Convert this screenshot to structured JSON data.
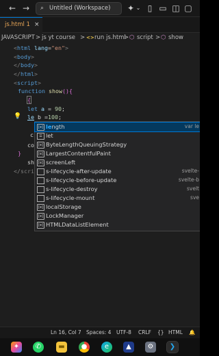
{
  "titlebar": {
    "search_text": "Untitled (Workspace)",
    "icons": [
      "back-arrow-icon",
      "forward-arrow-icon",
      "search-icon",
      "copilot-icon",
      "chevron-down-icon",
      "layout-sidebar-icon",
      "layout-panel-icon",
      "layout-secondary-icon"
    ]
  },
  "tab": {
    "label": "js.html 1",
    "close": "×"
  },
  "breadcrumb": {
    "p1": "JAVASCRIPT",
    "p2": "js yt course",
    "p3": "run js.html",
    "p4": "script",
    "p5": "show",
    "sep": ">"
  },
  "code": {
    "l1_a": "<",
    "l1_b": "html",
    "l1_c": "lang",
    "l1_d": "=",
    "l1_e": "\"en\"",
    "l1_f": ">",
    "l2_a": "<",
    "l2_b": "body",
    "l2_c": ">",
    "l3_a": "</",
    "l3_b": "body",
    "l3_c": ">",
    "l4_a": "</",
    "l4_b": "html",
    "l4_c": ">",
    "l5_a": "<",
    "l5_b": "script",
    "l5_c": ">",
    "l6_a": "function",
    "l6_b": "show",
    "l6_c": "(){",
    "l7": "{",
    "l8_a": "let",
    "l8_b": "a",
    "l8_c": " = ",
    "l8_d": "90",
    "l8_e": ";",
    "l9_a": "le",
    "l9_b": " b =",
    "l9_c": "100",
    "l9_d": ";",
    "l10": "c",
    "l11": "co",
    "l12": "}",
    "l13": "sh",
    "l14": "</scri"
  },
  "suggestions": [
    {
      "label_match": "le",
      "label_rest": "ngth",
      "detail": "var le",
      "kind": "field"
    },
    {
      "label_match": "",
      "label_rest": "let",
      "detail": "",
      "kind": "keyword"
    },
    {
      "label_match": "",
      "label_rest": "ByteLengthQueuingStrategy",
      "detail": "",
      "kind": "field"
    },
    {
      "label_match": "",
      "label_rest": "LargestContentfulPaint",
      "detail": "",
      "kind": "field"
    },
    {
      "label_match": "",
      "label_rest": "screenLeft",
      "detail": "",
      "kind": "field"
    },
    {
      "label_match": "",
      "label_rest": "s-lifecycle-after-update",
      "detail": "svelte-",
      "kind": "snippet"
    },
    {
      "label_match": "",
      "label_rest": "s-lifecycle-before-update",
      "detail": "svelte-b",
      "kind": "snippet"
    },
    {
      "label_match": "",
      "label_rest": "s-lifecycle-destroy",
      "detail": "svelt",
      "kind": "snippet"
    },
    {
      "label_match": "",
      "label_rest": "s-lifecycle-mount",
      "detail": "sve",
      "kind": "snippet"
    },
    {
      "label_match": "",
      "label_rest": "localStorage",
      "detail": "",
      "kind": "field"
    },
    {
      "label_match": "",
      "label_rest": "LockManager",
      "detail": "",
      "kind": "field"
    },
    {
      "label_match": "",
      "label_rest": "HTMLDataListElement",
      "detail": "",
      "kind": "field"
    }
  ],
  "statusbar": {
    "position": "Ln 16, Col 7",
    "spaces": "Spaces: 4",
    "encoding": "UTF-8",
    "eol": "CRLF",
    "language": "HTML",
    "braces": "{}"
  },
  "taskbar": {
    "icons": [
      "copilot-icon",
      "whatsapp-icon",
      "file-explorer-icon",
      "chrome-icon",
      "edge-icon",
      "photos-icon",
      "settings-icon",
      "vscode-icon"
    ]
  },
  "colors": {
    "accent": "#0078d4",
    "editor_bg": "#1e1e1e",
    "keyword": "#569cd6",
    "function": "#dcdcaa",
    "number": "#b5cea8",
    "match": "#2aaaff"
  }
}
